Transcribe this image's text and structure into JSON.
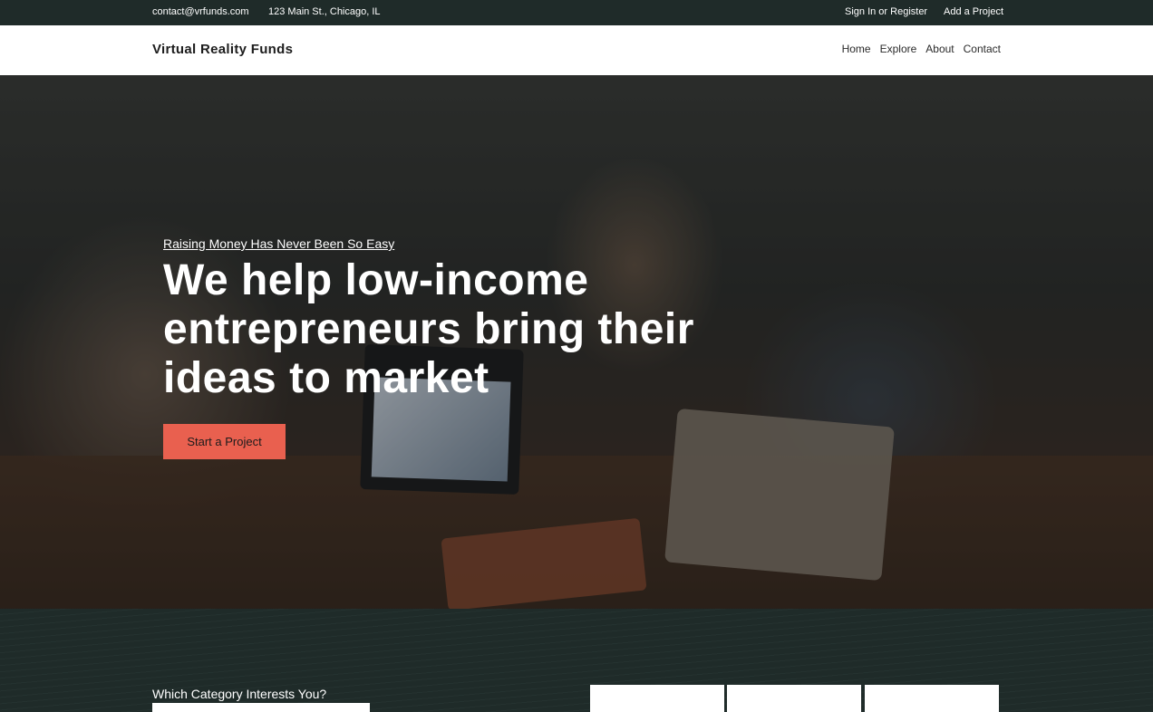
{
  "topbar": {
    "email": "contact@vrfunds.com",
    "address": "123 Main St., Chicago, IL",
    "sign_in": "Sign In or Register",
    "add_project": "Add a Project"
  },
  "nav": {
    "brand": "Virtual Reality Funds",
    "links": [
      "Home",
      "Explore",
      "About",
      "Contact"
    ]
  },
  "hero": {
    "subtitle": "Raising Money Has Never Been So Easy",
    "title": "We help low-income entrepreneurs bring their ideas to market",
    "cta": "Start a Project"
  },
  "category": {
    "label": "Which Category Interests You?"
  },
  "colors": {
    "topbar_bg": "#1f2b29",
    "accent": "#e9604f"
  }
}
